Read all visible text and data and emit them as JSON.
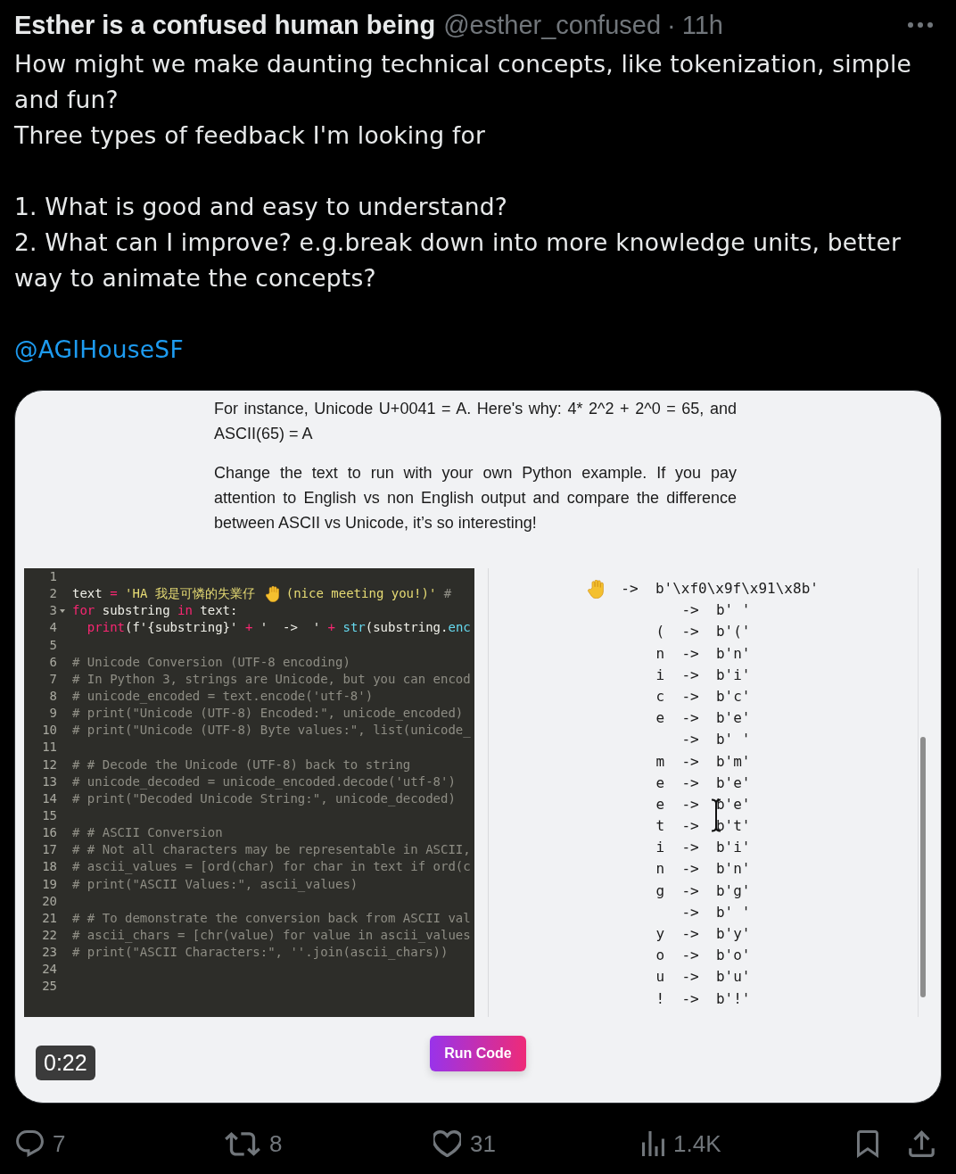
{
  "post": {
    "author_name": "Esther is a confused human being",
    "handle": "@esther_confused",
    "separator": "·",
    "time": "11h",
    "body": [
      {
        "lines": [
          {
            "kind": "text",
            "text": "How might we make daunting technical concepts, like tokenization, simple and fun?"
          },
          {
            "kind": "text",
            "text": "Three types of feedback I'm looking for"
          }
        ]
      },
      {
        "lines": [
          {
            "kind": "text",
            "text": "1. What is good and easy to understand?"
          },
          {
            "kind": "text",
            "text": "2. What can I improve? e.g.break down into more knowledge units, better way to animate the concepts?"
          }
        ]
      },
      {
        "lines": [
          {
            "kind": "mention",
            "text": "@AGIHouseSF"
          }
        ]
      }
    ]
  },
  "media": {
    "intro_paragraphs": [
      "For instance, Unicode U+0041 = A. Here's why: 4* 2^2 + 2^0 = 65, and ASCII(65) = A",
      "Change the text to run with your own Python example. If you pay attention to English vs non English output and compare the difference between ASCII vs Unicode, it’s so interesting!"
    ],
    "editor": {
      "lines": [
        {
          "number": "1",
          "fold": false
        },
        {
          "number": "2",
          "fold": false,
          "tokens": [
            {
              "kind": "plain",
              "text": "text "
            },
            {
              "kind": "keyword",
              "text": "="
            },
            {
              "kind": "string",
              "text": " 'HA 我是可憐的失業仔"
            },
            {
              "kind": "emoji"
            },
            {
              "kind": "string",
              "text": "(nice meeting you!)'"
            },
            {
              "kind": "comment",
              "text": " #"
            }
          ]
        },
        {
          "number": "3",
          "fold": true,
          "tokens": [
            {
              "kind": "keyword",
              "text": "for"
            },
            {
              "kind": "plain",
              "text": " substring "
            },
            {
              "kind": "keyword",
              "text": "in"
            },
            {
              "kind": "plain",
              "text": " text:"
            }
          ]
        },
        {
          "number": "4",
          "fold": false,
          "tokens": [
            {
              "kind": "keyword",
              "text": "  print"
            },
            {
              "kind": "plain",
              "text": "(f'{substring}' "
            },
            {
              "kind": "keyword",
              "text": "+"
            },
            {
              "kind": "plain",
              "text": " '  ->  ' "
            },
            {
              "kind": "keyword",
              "text": "+ "
            },
            {
              "kind": "builtin",
              "text": "str"
            },
            {
              "kind": "plain",
              "text": "(substring."
            },
            {
              "kind": "builtin",
              "text": "enc"
            }
          ]
        },
        {
          "number": "5",
          "fold": false
        },
        {
          "number": "6",
          "fold": false,
          "tokens": [
            {
              "kind": "comment",
              "text": "# Unicode Conversion (UTF-8 encoding)"
            }
          ]
        },
        {
          "number": "7",
          "fold": false,
          "tokens": [
            {
              "kind": "comment",
              "text": "# In Python 3, strings are Unicode, but you can encod"
            }
          ]
        },
        {
          "number": "8",
          "fold": false,
          "tokens": [
            {
              "kind": "comment",
              "text": "# unicode_encoded = text.encode('utf-8')"
            }
          ]
        },
        {
          "number": "9",
          "fold": false,
          "tokens": [
            {
              "kind": "comment",
              "text": "# print(\"Unicode (UTF-8) Encoded:\", unicode_encoded)"
            }
          ]
        },
        {
          "number": "10",
          "fold": false,
          "tokens": [
            {
              "kind": "comment",
              "text": "# print(\"Unicode (UTF-8) Byte values:\", list(unicode_"
            }
          ]
        },
        {
          "number": "11",
          "fold": false
        },
        {
          "number": "12",
          "fold": false,
          "tokens": [
            {
              "kind": "comment",
              "text": "# # Decode the Unicode (UTF-8) back to string"
            }
          ]
        },
        {
          "number": "13",
          "fold": false,
          "tokens": [
            {
              "kind": "comment",
              "text": "# unicode_decoded = unicode_encoded.decode('utf-8')"
            }
          ]
        },
        {
          "number": "14",
          "fold": false,
          "tokens": [
            {
              "kind": "comment",
              "text": "# print(\"Decoded Unicode String:\", unicode_decoded)"
            }
          ]
        },
        {
          "number": "15",
          "fold": false
        },
        {
          "number": "16",
          "fold": false,
          "tokens": [
            {
              "kind": "comment",
              "text": "# # ASCII Conversion"
            }
          ]
        },
        {
          "number": "17",
          "fold": false,
          "tokens": [
            {
              "kind": "comment",
              "text": "# # Not all characters may be representable in ASCII,"
            }
          ]
        },
        {
          "number": "18",
          "fold": false,
          "tokens": [
            {
              "kind": "comment",
              "text": "# ascii_values = [ord(char) for char in text if ord(c"
            }
          ]
        },
        {
          "number": "19",
          "fold": false,
          "tokens": [
            {
              "kind": "comment",
              "text": "# print(\"ASCII Values:\", ascii_values)"
            }
          ]
        },
        {
          "number": "20",
          "fold": false
        },
        {
          "number": "21",
          "fold": false,
          "tokens": [
            {
              "kind": "comment",
              "text": "# # To demonstrate the conversion back from ASCII val"
            }
          ]
        },
        {
          "number": "22",
          "fold": false,
          "tokens": [
            {
              "kind": "comment",
              "text": "# ascii_chars = [chr(value) for value in ascii_values"
            }
          ]
        },
        {
          "number": "23",
          "fold": false,
          "tokens": [
            {
              "kind": "comment",
              "text": "# print(\"ASCII Characters:\", ''.join(ascii_chars))"
            }
          ]
        },
        {
          "number": "24",
          "fold": false
        },
        {
          "number": "25",
          "fold": false
        }
      ]
    },
    "output": {
      "rows": [
        {
          "kind": "emoji",
          "arrow": "->",
          "bytes": "b'\\xf0\\x9f\\x91\\x8b'"
        },
        {
          "kind": "space",
          "arrow": "->",
          "bytes": "b' '"
        },
        {
          "kind": "char",
          "char": "(",
          "arrow": "->",
          "bytes": "b'('"
        },
        {
          "kind": "char",
          "char": "n",
          "arrow": "->",
          "bytes": "b'n'"
        },
        {
          "kind": "char",
          "char": "i",
          "arrow": "->",
          "bytes": "b'i'"
        },
        {
          "kind": "char",
          "char": "c",
          "arrow": "->",
          "bytes": "b'c'"
        },
        {
          "kind": "char",
          "char": "e",
          "arrow": "->",
          "bytes": "b'e'"
        },
        {
          "kind": "space",
          "arrow": "->",
          "bytes": "b' '"
        },
        {
          "kind": "char",
          "char": "m",
          "arrow": "->",
          "bytes": "b'm'"
        },
        {
          "kind": "char",
          "char": "e",
          "arrow": "->",
          "bytes": "b'e'"
        },
        {
          "kind": "char",
          "char": "e",
          "arrow": "->",
          "bytes": "b'e'"
        },
        {
          "kind": "char",
          "char": "t",
          "arrow": "->",
          "bytes": "b't'"
        },
        {
          "kind": "char",
          "char": "i",
          "arrow": "->",
          "bytes": "b'i'"
        },
        {
          "kind": "char",
          "char": "n",
          "arrow": "->",
          "bytes": "b'n'"
        },
        {
          "kind": "char",
          "char": "g",
          "arrow": "->",
          "bytes": "b'g'"
        },
        {
          "kind": "space",
          "arrow": "->",
          "bytes": "b' '"
        },
        {
          "kind": "char",
          "char": "y",
          "arrow": "->",
          "bytes": "b'y'"
        },
        {
          "kind": "char",
          "char": "o",
          "arrow": "->",
          "bytes": "b'o'"
        },
        {
          "kind": "char",
          "char": "u",
          "arrow": "->",
          "bytes": "b'u'"
        },
        {
          "kind": "char",
          "char": "!",
          "arrow": "->",
          "bytes": "b'!'"
        }
      ]
    },
    "run_button": "Run Code",
    "duration": "0:22"
  },
  "actions": [
    {
      "kind": "reply",
      "count": "7"
    },
    {
      "kind": "repost",
      "count": "8"
    },
    {
      "kind": "like",
      "count": "31"
    },
    {
      "kind": "views",
      "count": "1.4K"
    },
    {
      "kind": "bookmark"
    },
    {
      "kind": "share"
    }
  ]
}
